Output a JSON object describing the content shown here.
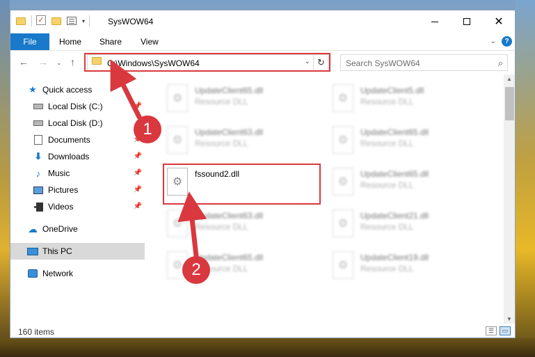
{
  "window": {
    "title": "SysWOW64",
    "qat_dropdown_glyph": "▾"
  },
  "ribbon": {
    "tabs": [
      {
        "label": "File"
      },
      {
        "label": "Home"
      },
      {
        "label": "Share"
      },
      {
        "label": "View"
      }
    ],
    "help": "?"
  },
  "address_bar": {
    "path": "C:\\Windows\\SysWOW64"
  },
  "search": {
    "placeholder": "Search SysWOW64"
  },
  "nav_pane": {
    "items": [
      {
        "label": "Quick access",
        "icon": "star-icon",
        "pinned": false
      },
      {
        "label": "Local Disk (C:)",
        "icon": "disk-icon",
        "pinned": true
      },
      {
        "label": "Local Disk (D:)",
        "icon": "disk-icon",
        "pinned": false
      },
      {
        "label": "Documents",
        "icon": "documents-icon",
        "pinned": true
      },
      {
        "label": "Downloads",
        "icon": "download-icon",
        "pinned": true
      },
      {
        "label": "Music",
        "icon": "music-icon",
        "pinned": true
      },
      {
        "label": "Pictures",
        "icon": "pictures-icon",
        "pinned": true
      },
      {
        "label": "Videos",
        "icon": "videos-icon",
        "pinned": true
      },
      {
        "label": "OneDrive",
        "icon": "cloud-icon",
        "pinned": false
      },
      {
        "label": "This PC",
        "icon": "computer-icon",
        "pinned": false,
        "selected": true
      },
      {
        "label": "Network",
        "icon": "network-icon",
        "pinned": false
      }
    ]
  },
  "files": {
    "left_column": [
      {
        "name": "UpdateClient65.dll",
        "type": "Resource DLL"
      },
      {
        "name": "UpdateClient63.dll",
        "type": "Resource DLL"
      },
      {
        "name": "fssound2.dll",
        "type": ""
      },
      {
        "name": "UpdateClient63.dll",
        "type": "Resource DLL"
      },
      {
        "name": "UpdateClient65.dll",
        "type": "Resource DLL"
      }
    ],
    "right_column": [
      {
        "name": "UpdateClient5.dll",
        "type": "Resource DLL"
      },
      {
        "name": "UpdateClient65.dll",
        "type": "Resource DLL"
      },
      {
        "name": "UpdateClient65.dll",
        "type": "Resource DLL"
      },
      {
        "name": "UpdateClient21.dll",
        "type": "Resource DLL"
      },
      {
        "name": "UpdateClient19.dll",
        "type": "Resource DLL"
      }
    ]
  },
  "status_bar": {
    "item_count": "160 items"
  },
  "callouts": {
    "step1": "1",
    "step2": "2"
  },
  "colors": {
    "accent": "#1979ca",
    "highlight": "#d9383e",
    "selected_nav": "#d9d9d9"
  }
}
